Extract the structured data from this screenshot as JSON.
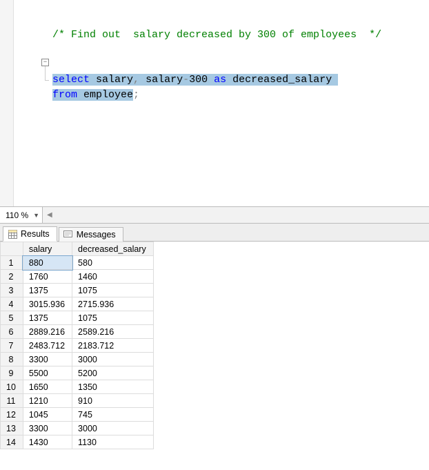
{
  "editor": {
    "comment": "/* Find out  salary decreased by 300 of employees  */",
    "kw_select": "select",
    "col1": "salary",
    "comma": ",",
    "col2a": "salary",
    "minus": "-",
    "lit300": "300",
    "kw_as": "as",
    "alias": "decreased_salary",
    "kw_from": "from",
    "table": "employee",
    "semi": ";"
  },
  "zoom": {
    "value": "110 %"
  },
  "tabs": {
    "results": "Results",
    "messages": "Messages"
  },
  "grid": {
    "columns": [
      "salary",
      "decreased_salary"
    ],
    "rows": [
      [
        "880",
        "580"
      ],
      [
        "1760",
        "1460"
      ],
      [
        "1375",
        "1075"
      ],
      [
        "3015.936",
        "2715.936"
      ],
      [
        "1375",
        "1075"
      ],
      [
        "2889.216",
        "2589.216"
      ],
      [
        "2483.712",
        "2183.712"
      ],
      [
        "3300",
        "3000"
      ],
      [
        "5500",
        "5200"
      ],
      [
        "1650",
        "1350"
      ],
      [
        "1210",
        "910"
      ],
      [
        "1045",
        "745"
      ],
      [
        "3300",
        "3000"
      ],
      [
        "1430",
        "1130"
      ]
    ]
  }
}
